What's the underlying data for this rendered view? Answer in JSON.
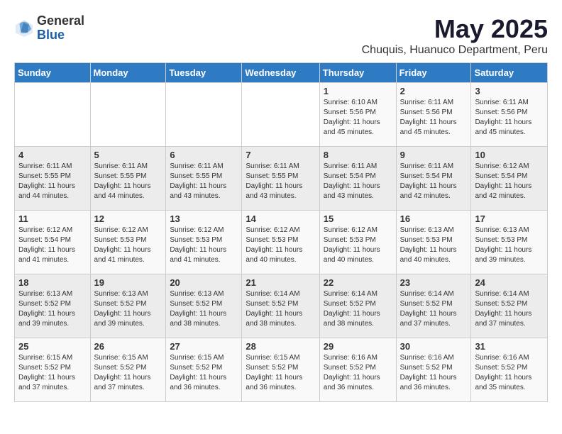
{
  "logo": {
    "general": "General",
    "blue": "Blue"
  },
  "title": "May 2025",
  "location": "Chuquis, Huanuco Department, Peru",
  "headers": [
    "Sunday",
    "Monday",
    "Tuesday",
    "Wednesday",
    "Thursday",
    "Friday",
    "Saturday"
  ],
  "weeks": [
    [
      {
        "day": "",
        "text": ""
      },
      {
        "day": "",
        "text": ""
      },
      {
        "day": "",
        "text": ""
      },
      {
        "day": "",
        "text": ""
      },
      {
        "day": "1",
        "text": "Sunrise: 6:10 AM\nSunset: 5:56 PM\nDaylight: 11 hours\nand 45 minutes."
      },
      {
        "day": "2",
        "text": "Sunrise: 6:11 AM\nSunset: 5:56 PM\nDaylight: 11 hours\nand 45 minutes."
      },
      {
        "day": "3",
        "text": "Sunrise: 6:11 AM\nSunset: 5:56 PM\nDaylight: 11 hours\nand 45 minutes."
      }
    ],
    [
      {
        "day": "4",
        "text": "Sunrise: 6:11 AM\nSunset: 5:55 PM\nDaylight: 11 hours\nand 44 minutes."
      },
      {
        "day": "5",
        "text": "Sunrise: 6:11 AM\nSunset: 5:55 PM\nDaylight: 11 hours\nand 44 minutes."
      },
      {
        "day": "6",
        "text": "Sunrise: 6:11 AM\nSunset: 5:55 PM\nDaylight: 11 hours\nand 43 minutes."
      },
      {
        "day": "7",
        "text": "Sunrise: 6:11 AM\nSunset: 5:55 PM\nDaylight: 11 hours\nand 43 minutes."
      },
      {
        "day": "8",
        "text": "Sunrise: 6:11 AM\nSunset: 5:54 PM\nDaylight: 11 hours\nand 43 minutes."
      },
      {
        "day": "9",
        "text": "Sunrise: 6:11 AM\nSunset: 5:54 PM\nDaylight: 11 hours\nand 42 minutes."
      },
      {
        "day": "10",
        "text": "Sunrise: 6:12 AM\nSunset: 5:54 PM\nDaylight: 11 hours\nand 42 minutes."
      }
    ],
    [
      {
        "day": "11",
        "text": "Sunrise: 6:12 AM\nSunset: 5:54 PM\nDaylight: 11 hours\nand 41 minutes."
      },
      {
        "day": "12",
        "text": "Sunrise: 6:12 AM\nSunset: 5:53 PM\nDaylight: 11 hours\nand 41 minutes."
      },
      {
        "day": "13",
        "text": "Sunrise: 6:12 AM\nSunset: 5:53 PM\nDaylight: 11 hours\nand 41 minutes."
      },
      {
        "day": "14",
        "text": "Sunrise: 6:12 AM\nSunset: 5:53 PM\nDaylight: 11 hours\nand 40 minutes."
      },
      {
        "day": "15",
        "text": "Sunrise: 6:12 AM\nSunset: 5:53 PM\nDaylight: 11 hours\nand 40 minutes."
      },
      {
        "day": "16",
        "text": "Sunrise: 6:13 AM\nSunset: 5:53 PM\nDaylight: 11 hours\nand 40 minutes."
      },
      {
        "day": "17",
        "text": "Sunrise: 6:13 AM\nSunset: 5:53 PM\nDaylight: 11 hours\nand 39 minutes."
      }
    ],
    [
      {
        "day": "18",
        "text": "Sunrise: 6:13 AM\nSunset: 5:52 PM\nDaylight: 11 hours\nand 39 minutes."
      },
      {
        "day": "19",
        "text": "Sunrise: 6:13 AM\nSunset: 5:52 PM\nDaylight: 11 hours\nand 39 minutes."
      },
      {
        "day": "20",
        "text": "Sunrise: 6:13 AM\nSunset: 5:52 PM\nDaylight: 11 hours\nand 38 minutes."
      },
      {
        "day": "21",
        "text": "Sunrise: 6:14 AM\nSunset: 5:52 PM\nDaylight: 11 hours\nand 38 minutes."
      },
      {
        "day": "22",
        "text": "Sunrise: 6:14 AM\nSunset: 5:52 PM\nDaylight: 11 hours\nand 38 minutes."
      },
      {
        "day": "23",
        "text": "Sunrise: 6:14 AM\nSunset: 5:52 PM\nDaylight: 11 hours\nand 37 minutes."
      },
      {
        "day": "24",
        "text": "Sunrise: 6:14 AM\nSunset: 5:52 PM\nDaylight: 11 hours\nand 37 minutes."
      }
    ],
    [
      {
        "day": "25",
        "text": "Sunrise: 6:15 AM\nSunset: 5:52 PM\nDaylight: 11 hours\nand 37 minutes."
      },
      {
        "day": "26",
        "text": "Sunrise: 6:15 AM\nSunset: 5:52 PM\nDaylight: 11 hours\nand 37 minutes."
      },
      {
        "day": "27",
        "text": "Sunrise: 6:15 AM\nSunset: 5:52 PM\nDaylight: 11 hours\nand 36 minutes."
      },
      {
        "day": "28",
        "text": "Sunrise: 6:15 AM\nSunset: 5:52 PM\nDaylight: 11 hours\nand 36 minutes."
      },
      {
        "day": "29",
        "text": "Sunrise: 6:16 AM\nSunset: 5:52 PM\nDaylight: 11 hours\nand 36 minutes."
      },
      {
        "day": "30",
        "text": "Sunrise: 6:16 AM\nSunset: 5:52 PM\nDaylight: 11 hours\nand 36 minutes."
      },
      {
        "day": "31",
        "text": "Sunrise: 6:16 AM\nSunset: 5:52 PM\nDaylight: 11 hours\nand 35 minutes."
      }
    ]
  ]
}
